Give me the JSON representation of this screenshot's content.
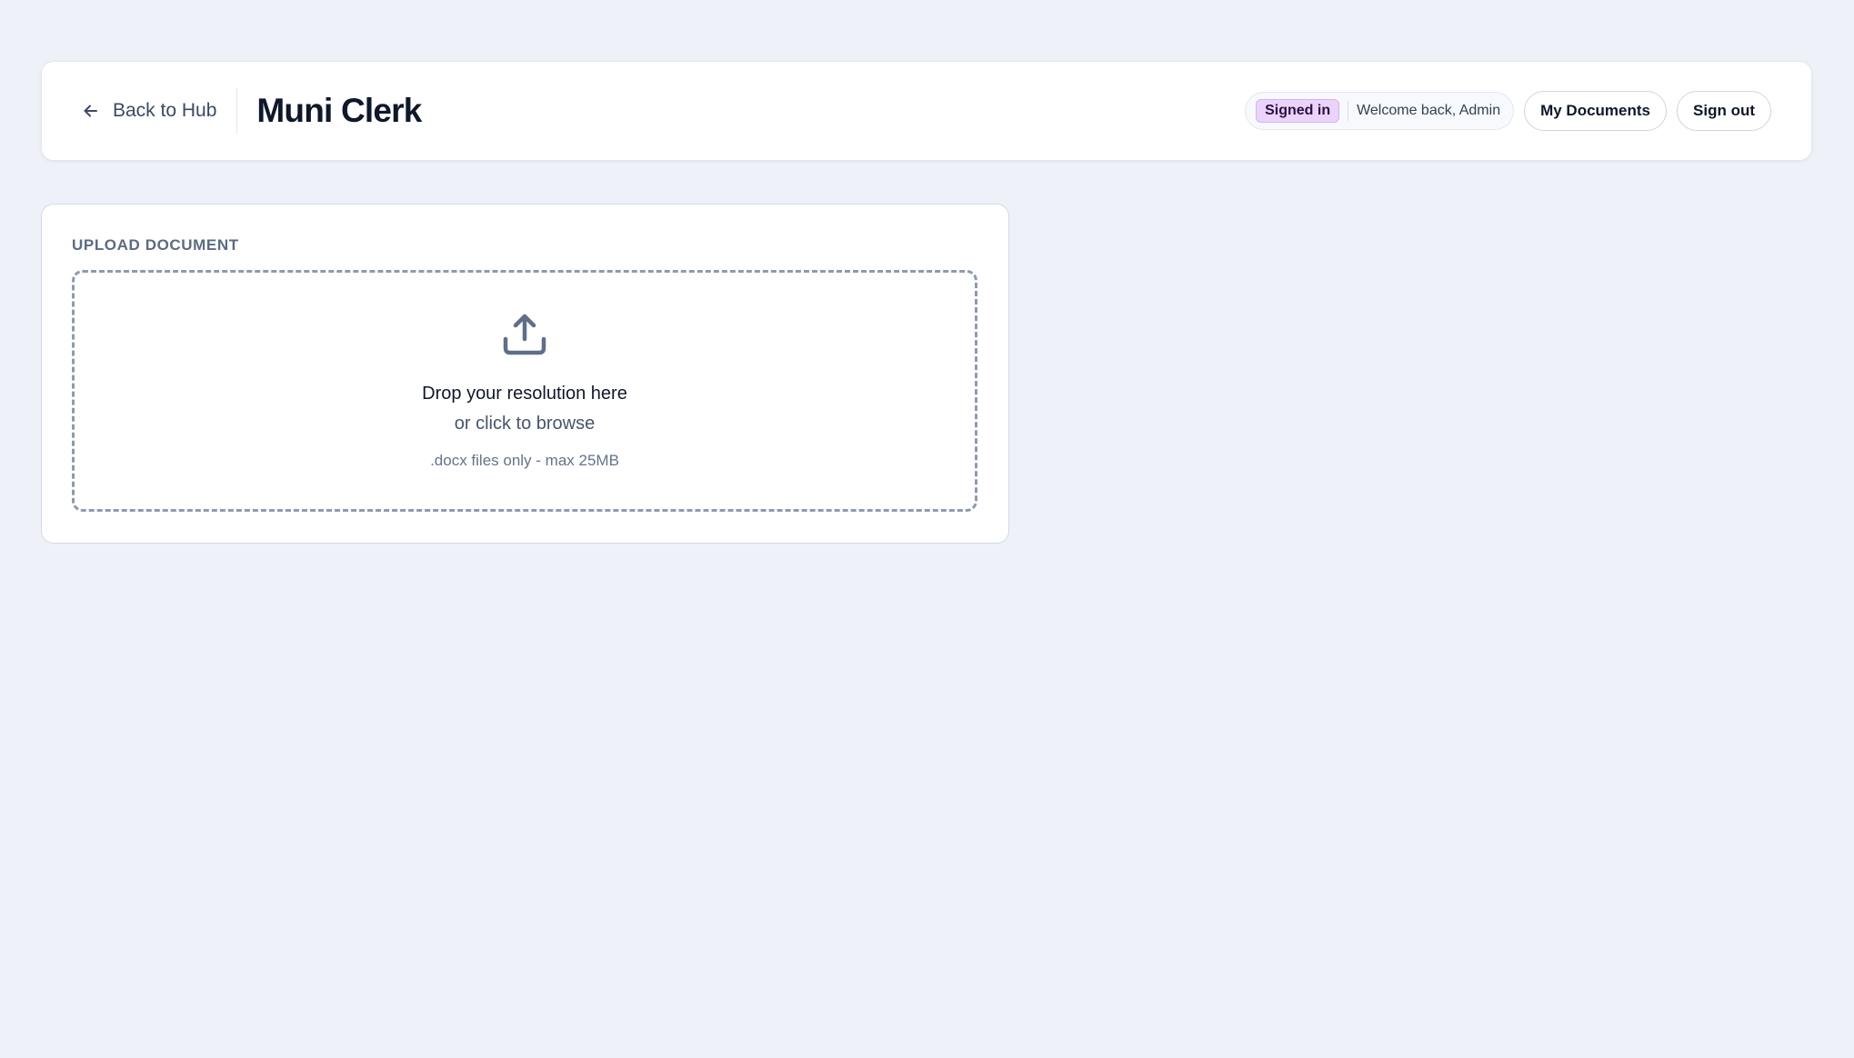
{
  "header": {
    "back_label": "Back to Hub",
    "title": "Muni Clerk",
    "status_badge": "Signed in",
    "welcome_text": "Welcome back, Admin",
    "my_documents_label": "My Documents",
    "sign_out_label": "Sign out"
  },
  "upload": {
    "section_label": "UPLOAD DOCUMENT",
    "drop_text": "Drop your resolution here",
    "browse_text": "or click to browse",
    "hint_text": ".docx files only - max 25MB",
    "icon": "upload-icon"
  },
  "colors": {
    "background": "#eef1f8",
    "badge_bg": "#ead4fb",
    "text_primary": "#0f172a",
    "text_muted": "#64748b"
  }
}
